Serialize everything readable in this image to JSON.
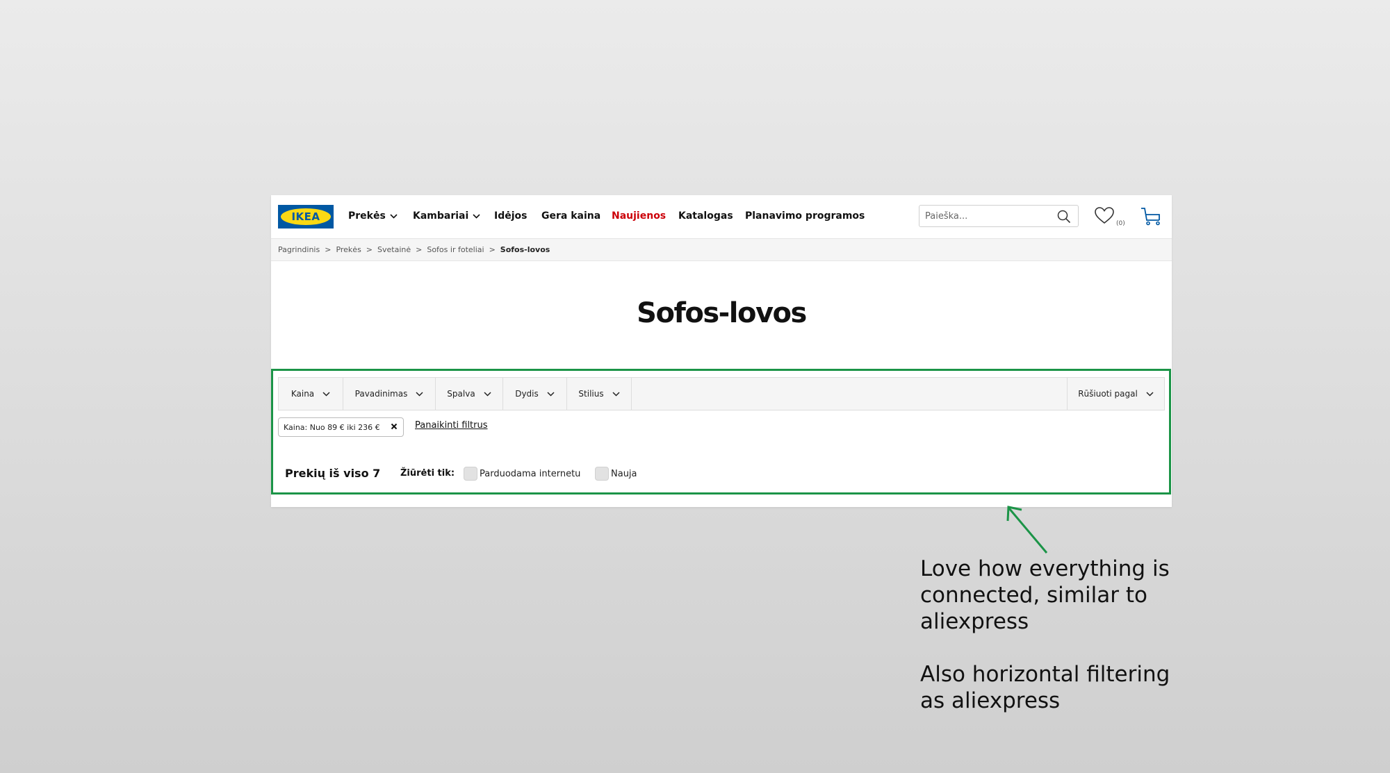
{
  "header": {
    "logo_text": "IKEA",
    "nav": [
      {
        "label": "Prekės",
        "dropdown": true
      },
      {
        "label": "Kambariai",
        "dropdown": true
      },
      {
        "label": "Idėjos",
        "dropdown": false
      },
      {
        "label": "Gera kaina",
        "dropdown": false
      },
      {
        "label": "Naujienos",
        "dropdown": false,
        "highlight": true
      },
      {
        "label": "Katalogas",
        "dropdown": false
      },
      {
        "label": "Planavimo programos",
        "dropdown": false
      }
    ],
    "search": {
      "placeholder": "Paieška..."
    },
    "wishlist_count": "(0)",
    "icons": {
      "search": "search-icon",
      "wishlist": "heart-icon",
      "cart": "shopping-cart-icon"
    }
  },
  "breadcrumb": [
    "Pagrindinis",
    "Prekės",
    "Svetainė",
    "Sofos ir foteliai",
    "Sofos-lovos"
  ],
  "breadcrumb_separator": ">",
  "page_title": "Sofos-lovos",
  "filters": [
    "Kaina",
    "Pavadinimas",
    "Spalva",
    "Dydis",
    "Stilius"
  ],
  "sort_label": "Rūšiuoti pagal",
  "active_filter": {
    "label": "Kaina: Nuo 89 € iki 236 €"
  },
  "clear_filters_label": "Panaikinti filtrus",
  "results": {
    "total_label": "Prekių iš viso 7",
    "view_only_label": "Žiūrėti tik:",
    "checkboxes": [
      {
        "label": "Parduodama internetu",
        "checked": false
      },
      {
        "label": "Nauja",
        "checked": false
      }
    ]
  },
  "annotation": {
    "line1": "Love how everything is connected, similar to aliexpress",
    "line2": "Also horizontal filtering as aliexpress"
  },
  "colors": {
    "ikea_blue": "#0058a3",
    "ikea_yellow": "#fbd914",
    "news_red": "#cc0008",
    "highlight_green": "#1b9447"
  }
}
